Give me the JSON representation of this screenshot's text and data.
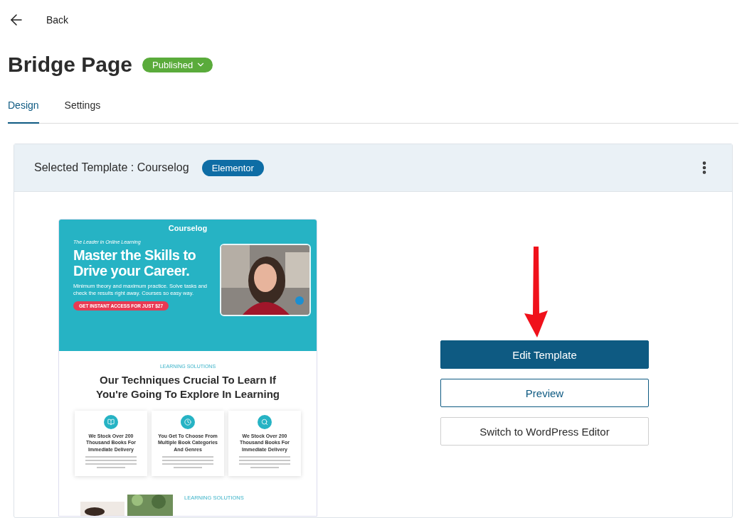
{
  "back": {
    "label": "Back"
  },
  "page": {
    "title": "Bridge Page",
    "status": {
      "label": "Published"
    }
  },
  "tabs": [
    {
      "label": "Design",
      "selected": true
    },
    {
      "label": "Settings",
      "selected": false
    }
  ],
  "template_card": {
    "heading_label": "Selected Template :",
    "template_name": "Courselog",
    "builder_badge": "Elementor"
  },
  "preview": {
    "logo": "Courselog",
    "tagline": "The Leader in Online Learning",
    "headline": "Master the Skills to Drive your Career.",
    "description": "Minimum theory and maximum practice. Solve tasks and check the results right away. Courses so easy way.",
    "cta": "GET INSTANT ACCESS FOR JUST $27",
    "eyebrow": "LEARNING SOLUTIONS",
    "heading": "Our Techniques Crucial To Learn If You're Going To Explore In Learning",
    "features": [
      {
        "title": "We Stock Over 200 Thousand Books For Immediate Delivery",
        "kind": "book"
      },
      {
        "title": "You Get To Choose From Multiple Book Categories And Genres",
        "kind": "clock"
      },
      {
        "title": "We Stock Over 200 Thousand Books For Immediate Delivery",
        "kind": "search"
      }
    ],
    "second_eyebrow": "LEARNING SOLUTIONS"
  },
  "buttons": [
    {
      "label": "Edit Template",
      "kind": "primary"
    },
    {
      "label": "Preview",
      "kind": "outline"
    },
    {
      "label": "Switch to WordPress Editor",
      "kind": "plain"
    }
  ]
}
